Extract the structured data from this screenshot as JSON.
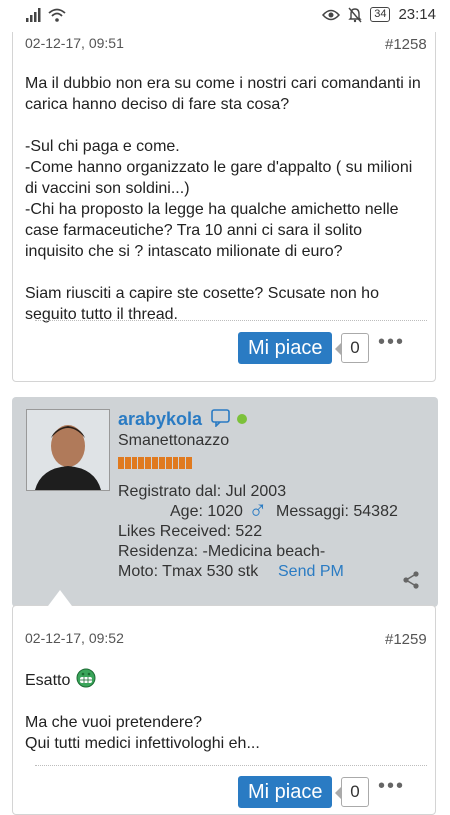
{
  "status_bar": {
    "time": "23:14",
    "battery": "34",
    "icons": [
      "signal-icon",
      "wifi-icon",
      "eye-icon",
      "bell-off-icon",
      "battery-icon"
    ]
  },
  "posts": [
    {
      "date": "02-12-17, 09:51",
      "number": "#1258",
      "paragraphs": [
        "Ma il dubbio non era su come i nostri cari comandanti in carica hanno deciso di fare sta cosa?",
        "-Sul chi paga e come.\n-Come hanno organizzato le gare d'appalto ( su milioni di vaccini son soldini...)\n-Chi ha proposto la legge ha qualche amichetto nelle case farmaceutiche? Tra 10 anni ci sara il solito inquisito che si ? intascato milionate di euro?",
        "Siam riusciti a capire ste cosette? Scusate non ho seguito tutto il thread."
      ],
      "like_label": "Mi piace",
      "like_count": "0",
      "more_label": "•••"
    },
    {
      "date": "02-12-17, 09:52",
      "number": "#1259",
      "paragraphs": [
        "Esatto",
        "Ma che vuoi pretendere?\nQui tutti medici infettivologhi eh..."
      ],
      "like_label": "Mi piace",
      "like_count": "0",
      "more_label": "•••"
    }
  ],
  "author": {
    "username": "arabykola",
    "title": "Smanettonazzo",
    "registered": "Registrato dal: Jul 2003",
    "age": "Age: 1020",
    "gender_symbol": "♂",
    "messages": "Messaggi: 54382",
    "likes": "Likes Received: 522",
    "residence": "Residenza: -Medicina beach-",
    "moto": "Moto: Tmax 530 stk",
    "send_pm": "Send PM",
    "online_color": "#7cc13a"
  }
}
